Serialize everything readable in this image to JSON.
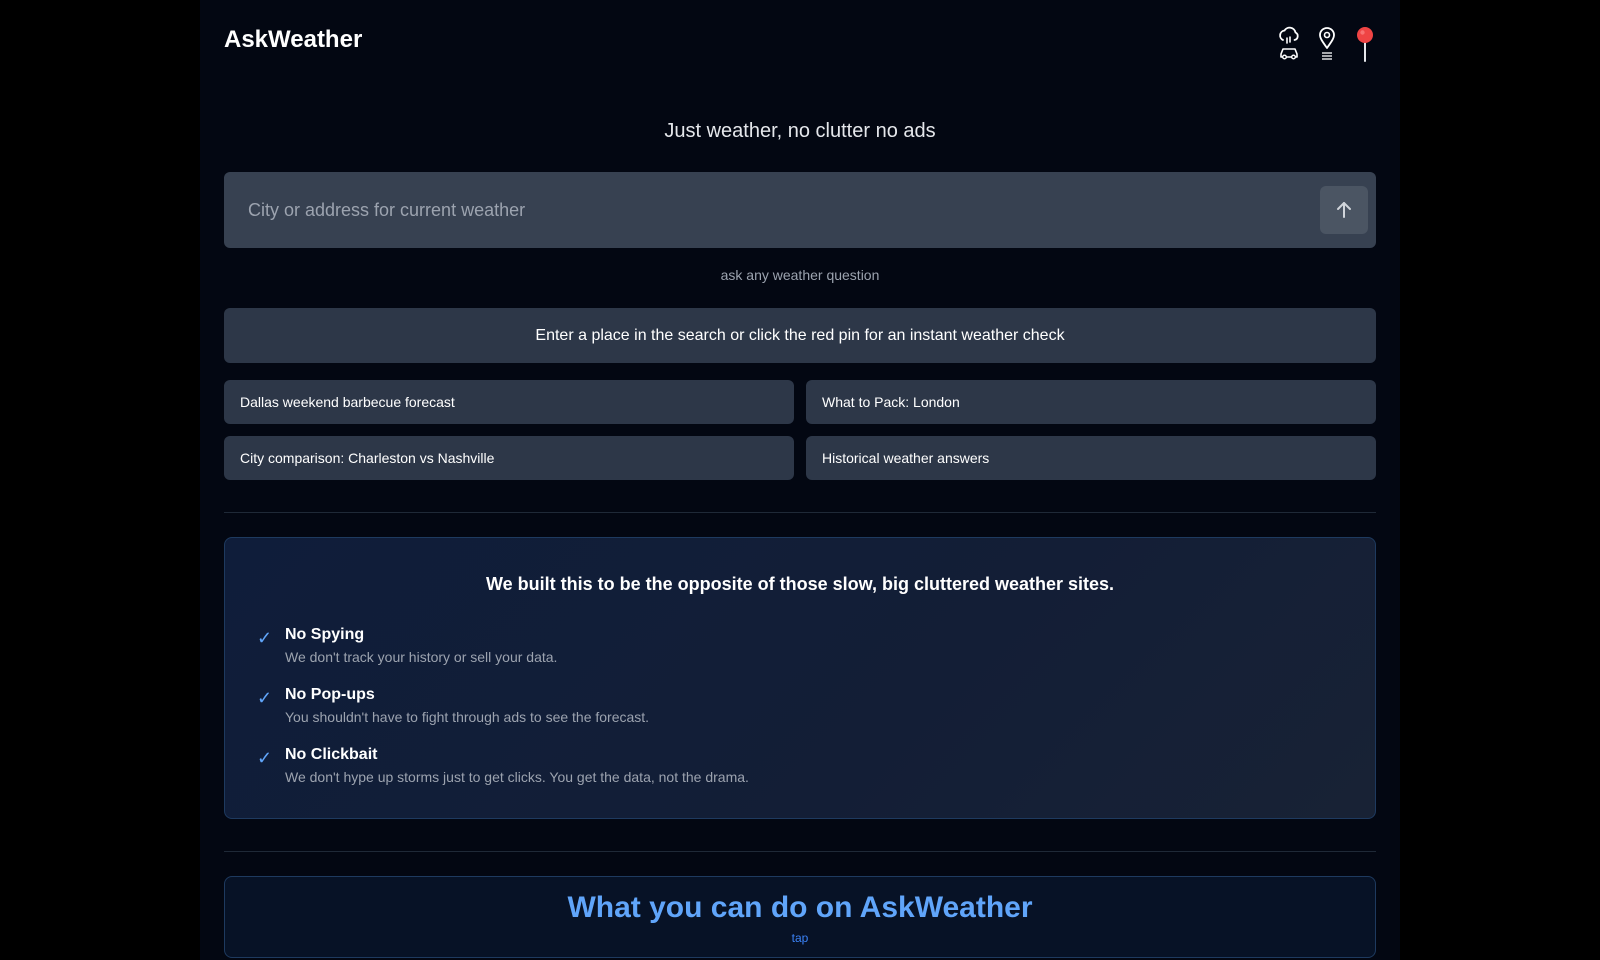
{
  "app": {
    "title": "AskWeather"
  },
  "header": {
    "icons": [
      {
        "name": "cloud-rain-car-icon"
      },
      {
        "name": "location-list-icon"
      },
      {
        "name": "red-pin-icon",
        "color": "#ef4444"
      }
    ]
  },
  "hero": {
    "tagline": "Just weather, no clutter no ads"
  },
  "search": {
    "value": "",
    "placeholder": "City or address for current weather",
    "submit_icon": "arrow-up-icon"
  },
  "hint": "ask any weather question",
  "info_bar": "Enter a place in the search or click the red pin for an instant weather check",
  "suggestions": [
    "Dallas weekend barbecue forecast",
    "What to Pack: London",
    "City comparison: Charleston vs Nashville",
    "Historical weather answers"
  ],
  "about": {
    "title": "We built this to be the opposite of those slow, big cluttered weather sites.",
    "check_glyph": "✓",
    "features": [
      {
        "title": "No Spying",
        "desc": "We don't track your history or sell your data."
      },
      {
        "title": "No Pop-ups",
        "desc": "You shouldn't have to fight through ads to see the forecast."
      },
      {
        "title": "No Clickbait",
        "desc": "We don't hype up storms just to get clicks. You get the data, not the drama."
      }
    ]
  },
  "cando": {
    "title": "What you can do on AskWeather",
    "subtitle": "tap"
  },
  "colors": {
    "accent": "#60a5fa",
    "pin": "#ef4444",
    "panel": "#2d3748",
    "input": "#374151"
  }
}
